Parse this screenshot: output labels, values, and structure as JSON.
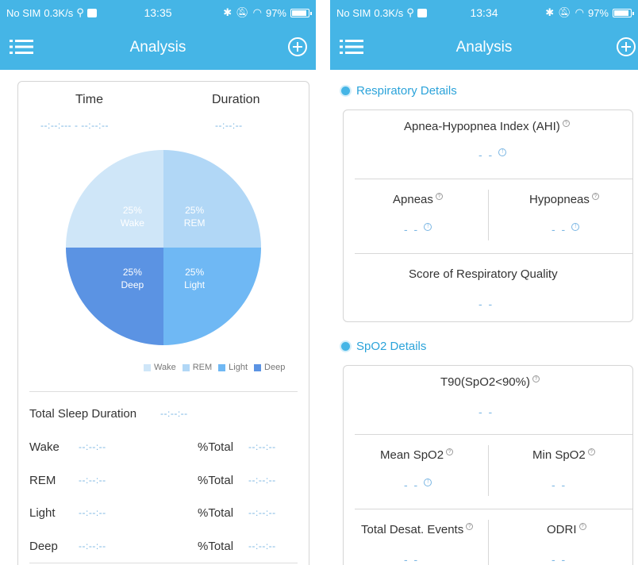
{
  "left": {
    "status": {
      "carrier": "No SIM",
      "speed": "0.3K/s",
      "time": "13:35",
      "battery": "97%"
    },
    "nav": {
      "title": "Analysis"
    },
    "summary": {
      "time_label": "Time",
      "duration_label": "Duration",
      "time_value": "--:--:--- - --:--:--",
      "duration_value": "--:--:--"
    },
    "chart_data": {
      "type": "pie",
      "slices": [
        {
          "name": "Wake",
          "value": 25,
          "percent_label": "25%",
          "color": "#cfe6f8"
        },
        {
          "name": "REM",
          "value": 25,
          "percent_label": "25%",
          "color": "#b1d7f6"
        },
        {
          "name": "Light",
          "value": 25,
          "percent_label": "25%",
          "color": "#6fb8f4"
        },
        {
          "name": "Deep",
          "value": 25,
          "percent_label": "25%",
          "color": "#5b93e3"
        }
      ],
      "legend": [
        "Wake",
        "REM",
        "Light",
        "Deep"
      ],
      "legend_position": "bottom-right"
    },
    "stats": {
      "total_label": "Total Sleep Duration",
      "total_value": "--:--:--",
      "rows": [
        {
          "label": "Wake",
          "value": "--:--:--",
          "pct_label": "%Total",
          "pct_value": "--:--:--"
        },
        {
          "label": "REM",
          "value": "--:--:--",
          "pct_label": "%Total",
          "pct_value": "--:--:--"
        },
        {
          "label": "Light",
          "value": "--:--:--",
          "pct_label": "%Total",
          "pct_value": "--:--:--"
        },
        {
          "label": "Deep",
          "value": "--:--:--",
          "pct_label": "%Total",
          "pct_value": "--:--:--"
        }
      ]
    }
  },
  "right": {
    "status": {
      "carrier": "No SIM",
      "speed": "0.3K/s",
      "time": "13:34",
      "battery": "97%"
    },
    "nav": {
      "title": "Analysis"
    },
    "respiratory": {
      "title": "Respiratory Details",
      "ahi_label": "Apnea-Hypopnea Index (AHI)",
      "ahi_value": "- -",
      "apneas_label": "Apneas",
      "apneas_value": "- -",
      "hypopneas_label": "Hypopneas",
      "hypopneas_value": "- -",
      "score_label": "Score of Respiratory Quality",
      "score_value": "- -"
    },
    "spo2": {
      "title": "SpO2 Details",
      "t90_label": "T90(SpO2<90%)",
      "t90_value": "- -",
      "mean_label": "Mean SpO2",
      "mean_value": "- -",
      "min_label": "Min SpO2",
      "min_value": "- -",
      "desat_label": "Total Desat. Events",
      "desat_value": "- -",
      "odri_label": "ODRI",
      "odri_value": "- -"
    }
  },
  "theme": {
    "accent": "#45b5e6",
    "value_color": "#7ab6e3"
  }
}
